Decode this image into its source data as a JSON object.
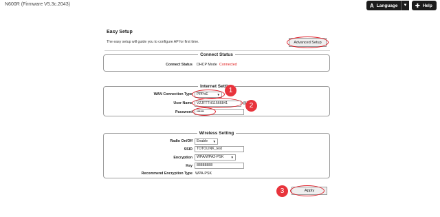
{
  "header": {
    "firmware_title": "N600R (Firmware V5.3c.2043)",
    "language_label": "Language",
    "help_label": "Help"
  },
  "easy_setup": {
    "title": "Easy Setup",
    "description": "The easy setup will guide you to configure AP for first time.",
    "advanced_button": "Advanced Setup"
  },
  "connect_status": {
    "legend": "Connect Status",
    "label": "Connect Status",
    "mode": "DHCP Mode",
    "state": "Connected"
  },
  "internet_setting": {
    "legend": "Internet Setting",
    "wan_label": "WAN Connection Type",
    "wan_value": "PPPoE",
    "username_label": "User Name",
    "username_value": "VZJFTTH11566841",
    "username_suffix": "@T",
    "password_label": "Password",
    "password_value": "••••••"
  },
  "wireless_setting": {
    "legend": "Wireless Setting",
    "radio_label": "Radio On/Off",
    "radio_value": "Enable",
    "ssid_label": "SSID",
    "ssid_value": "TOTOLINK_test",
    "encryption_label": "Encryption",
    "encryption_value": "WPA/WPA2-PSK",
    "key_label": "Key",
    "key_value": "88888888",
    "recommend_label": "Recommend Encryption Type",
    "recommend_value": "WPA-PSK"
  },
  "apply_button": "Apply",
  "markers": [
    "1",
    "2",
    "3"
  ],
  "colors": {
    "accent_red": "#e02020",
    "marker_red": "#e8343c",
    "topbar_button": "#1c1c1c"
  }
}
